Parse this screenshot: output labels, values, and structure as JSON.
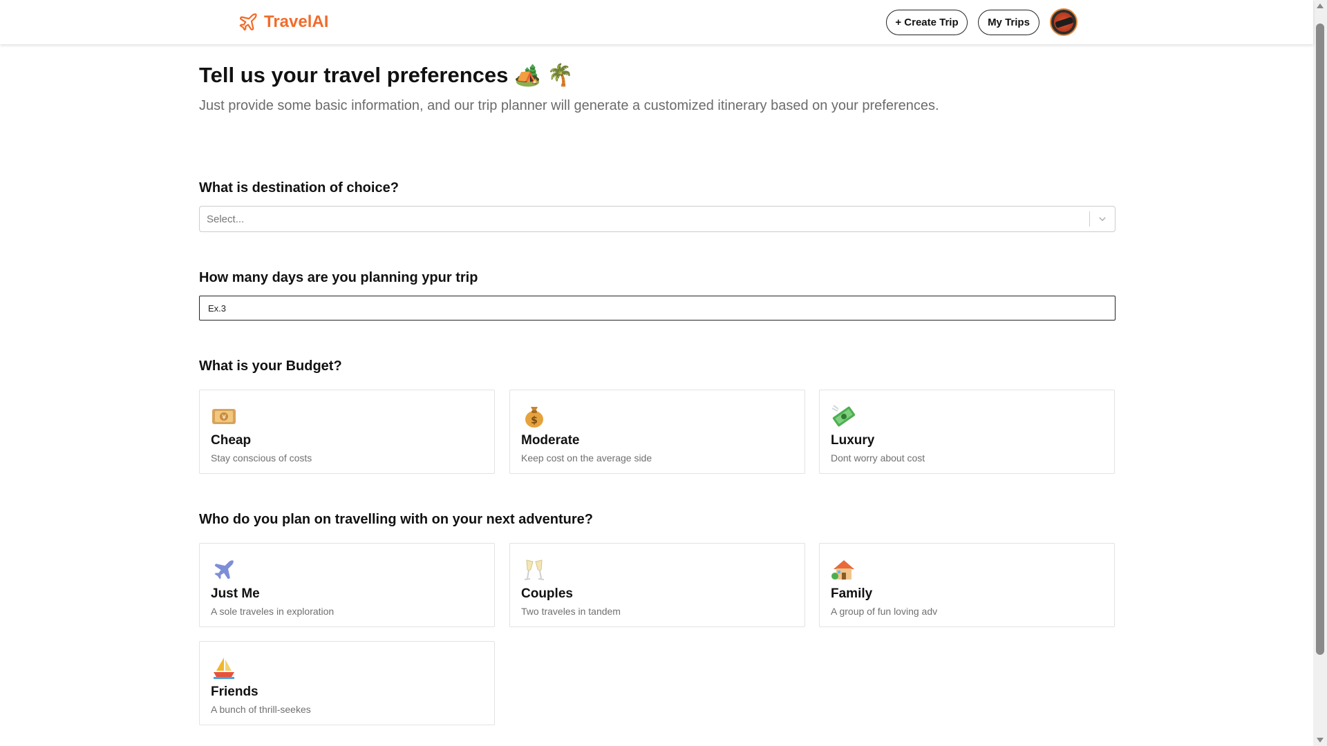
{
  "header": {
    "brand": "TravelAI",
    "create_trip_label": "+ Create Trip",
    "my_trips_label": "My Trips",
    "brand_color": "#f26b2a"
  },
  "page": {
    "title": "Tell us your travel preferences 🏕️ 🌴",
    "subtitle": "Just provide some basic information, and our trip planner will generate a customized itinerary based on your preferences."
  },
  "destination": {
    "question": "What is destination of choice?",
    "placeholder": "Select..."
  },
  "days": {
    "question": "How many days are you planning ypur trip",
    "placeholder": "Ex.3"
  },
  "budget": {
    "question": "What is your Budget?",
    "options": [
      {
        "icon": "💴",
        "title": "Cheap",
        "desc": "Stay conscious of costs"
      },
      {
        "icon": "💰",
        "title": "Moderate",
        "desc": "Keep cost on the average side"
      },
      {
        "icon": "💸",
        "title": "Luxury",
        "desc": "Dont worry about cost"
      }
    ]
  },
  "travelers": {
    "question": "Who do you plan on travelling with on your next adventure?",
    "options": [
      {
        "icon": "✈️",
        "title": "Just Me",
        "desc": "A sole traveles in exploration"
      },
      {
        "icon": "🥂",
        "title": "Couples",
        "desc": "Two traveles in tandem"
      },
      {
        "icon": "🏡",
        "title": "Family",
        "desc": "A group of fun loving adv"
      },
      {
        "icon": "⛵",
        "title": "Friends",
        "desc": "A bunch of thrill-seekes"
      }
    ]
  }
}
